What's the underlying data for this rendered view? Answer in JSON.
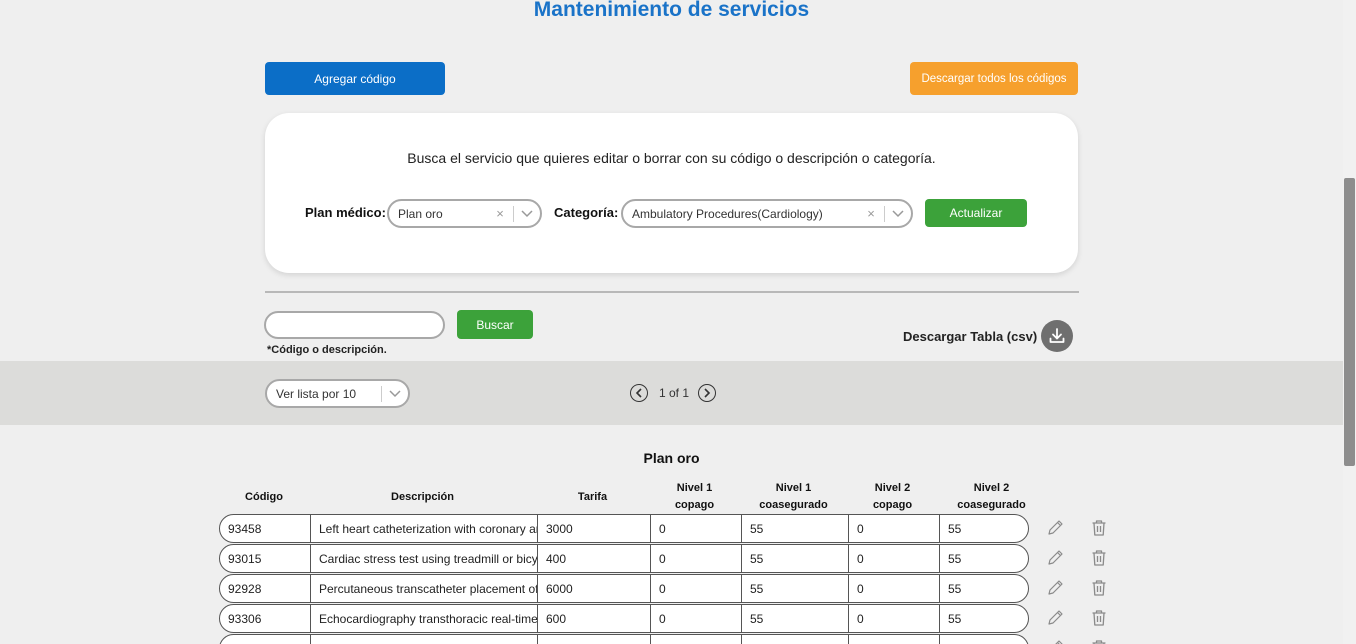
{
  "page": {
    "title": "Mantenimiento de servicios"
  },
  "actions": {
    "add_code": "Agregar código",
    "download_all": "Descargar todos los códigos"
  },
  "filter": {
    "instruction": "Busca el servicio que quieres editar o borrar con su código o descripción o categoría.",
    "plan_label": "Plan médico:",
    "plan_value": "Plan oro",
    "category_label": "Categoría:",
    "category_value": "Ambulatory Procedures(Cardiology)",
    "update_button": "Actualizar",
    "clear_glyph": "×"
  },
  "search": {
    "input_value": "",
    "button": "Buscar",
    "hint": "*Código o descripción.",
    "download_csv": "Descargar Tabla (csv)"
  },
  "pagination": {
    "page_size": "Ver lista por 10",
    "page_info": "1 of 1"
  },
  "table": {
    "title": "Plan oro",
    "columns": [
      {
        "line1": "Código",
        "line2": ""
      },
      {
        "line1": "Descripción",
        "line2": ""
      },
      {
        "line1": "Tarifa",
        "line2": ""
      },
      {
        "line1": "Nivel 1",
        "line2": "copago"
      },
      {
        "line1": "Nivel 1",
        "line2": "coasegurado"
      },
      {
        "line1": "Nivel 2",
        "line2": "copago"
      },
      {
        "line1": "Nivel 2",
        "line2": "coasegurado"
      }
    ],
    "rows": [
      {
        "code": "93458",
        "description": "Left heart catheterization with coronary ar",
        "tarifa": "3000",
        "n1_copago": "0",
        "n1_coaseg": "55",
        "n2_copago": "0",
        "n2_coaseg": "55"
      },
      {
        "code": "93015",
        "description": "Cardiac stress test using treadmill or bicyc",
        "tarifa": "400",
        "n1_copago": "0",
        "n1_coaseg": "55",
        "n2_copago": "0",
        "n2_coaseg": "55"
      },
      {
        "code": "92928",
        "description": "Percutaneous transcatheter placement of",
        "tarifa": "6000",
        "n1_copago": "0",
        "n1_coaseg": "55",
        "n2_copago": "0",
        "n2_coaseg": "55"
      },
      {
        "code": "93306",
        "description": "Echocardiography  transthoracic real-time",
        "tarifa": "600",
        "n1_copago": "0",
        "n1_coaseg": "55",
        "n2_copago": "0",
        "n2_coaseg": "55"
      },
      {
        "code": "",
        "description": "",
        "tarifa": "",
        "n1_copago": "",
        "n1_coaseg": "",
        "n2_copago": "",
        "n2_coaseg": ""
      }
    ]
  },
  "icons": {
    "edit": "pencil-icon",
    "delete": "trash-icon",
    "download": "download-icon",
    "prev": "chevron-left-icon",
    "next": "chevron-right-icon",
    "dropdown": "chevron-down-icon"
  },
  "colors": {
    "title": "#1a73c8",
    "primary": "#0b6ec7",
    "warning": "#f6a02d",
    "success": "#3ca23a",
    "background": "#efefef"
  }
}
